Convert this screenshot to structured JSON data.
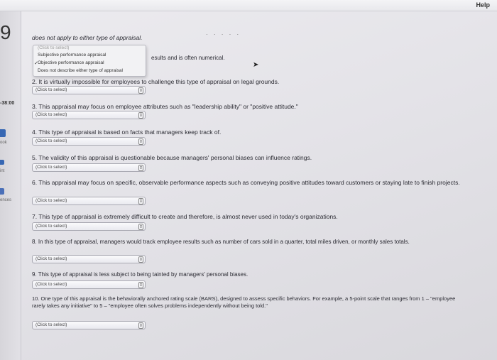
{
  "header": {
    "help_label": "Help"
  },
  "sidebar": {
    "question_number": "9",
    "timer": "-38:00",
    "items": [
      {
        "label": "ook"
      },
      {
        "label": "int"
      },
      {
        "label": "ences"
      }
    ]
  },
  "question_intro": "does not apply to either type of appraisal.",
  "question_1_visible_tail": "esults and is often numerical.",
  "dropdown": {
    "placeholder": "(Click to select)",
    "options": [
      {
        "label": "Subjective performance appraisal",
        "checked": false
      },
      {
        "label": "Objective performance appraisal",
        "checked": true
      },
      {
        "label": "Does not describe either type of appraisal",
        "checked": false
      }
    ]
  },
  "select_placeholder": "(Click to select)",
  "questions": [
    {
      "text": "2. It is virtually impossible for employees to challenge this type of appraisal on legal grounds."
    },
    {
      "text": "3. This appraisal may focus on employee attributes such as \"leadership ability\" or \"positive attitude.\""
    },
    {
      "text": "4. This type of appraisal is based on facts that managers keep track of."
    },
    {
      "text": "5. The validity of this appraisal is questionable because managers' personal biases can influence ratings."
    },
    {
      "text": "6. This appraisal may focus on specific, observable performance aspects such as conveying positive attitudes toward customers or staying late to finish projects."
    },
    {
      "text": "7. This type of appraisal is extremely difficult to create and therefore, is almost never used in today's organizations."
    },
    {
      "text": "8. In this type of appraisal, managers would track employee results such as number of cars sold in a quarter, total miles driven, or monthly sales totals."
    },
    {
      "text": "9. This type of appraisal is less subject to being tainted by managers' personal biases."
    },
    {
      "text": "10. One type of this appraisal is the behaviorally anchored rating scale (BARS), designed to assess specific behaviors. For example, a 5-point scale that ranges from 1 – \"employee rarely takes any initiative\" to 5 – \"employee often solves problems independently without being told.\""
    }
  ]
}
